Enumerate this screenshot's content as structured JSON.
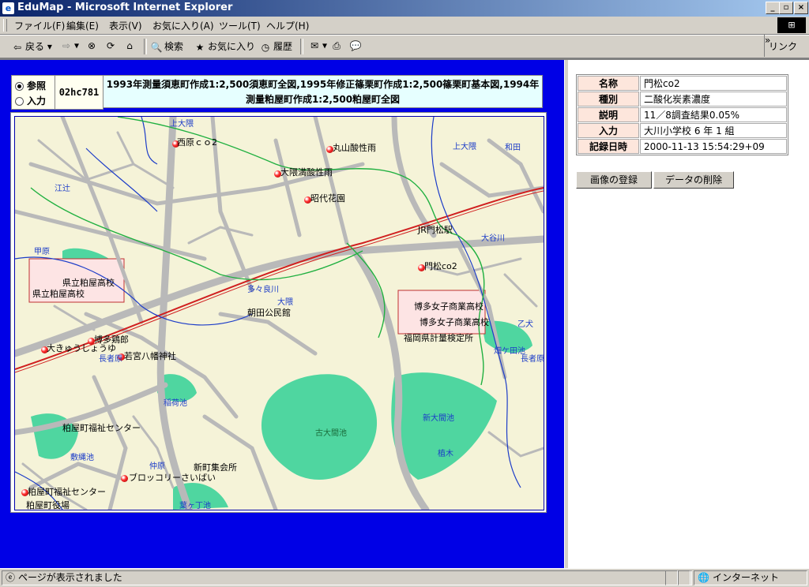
{
  "window": {
    "title": "EduMap - Microsoft Internet Explorer",
    "app_icon": "e"
  },
  "menu": [
    "ファイル(F)",
    "編集(E)",
    "表示(V)",
    "お気に入り(A)",
    "ツール(T)",
    "ヘルプ(H)"
  ],
  "toolbar": {
    "back": "戻る",
    "search": "検索",
    "favorites": "お気に入り",
    "history": "履歴",
    "links": "リンク"
  },
  "left": {
    "radio_ref": "参照",
    "radio_input": "入力",
    "code": "02hc781",
    "description": "1993年測量須恵町作成1:2,500須恵町全図,1995年修正篠栗町作成1:2,500篠栗町基本図,1994年測量粕屋町作成1:2,500粕屋町全図"
  },
  "map": {
    "places": [
      "西原ｃｏ2",
      "丸山酸性雨",
      "大隈満酸性雨",
      "昭代花園",
      "JR門松駅",
      "門松co2",
      "県立粕屋高校",
      "県立粕屋高校",
      "朝田公民館",
      "博多女子商業高校",
      "博多女子商業高校",
      "福岡県計量検定所",
      "大きゅうしょうゆ",
      "博多鶏郎",
      "若宮八幡神社",
      "粕屋町福祉センター",
      "新町集会所",
      "ブロッコリーさいばい",
      "粕屋町福祉センター",
      "粕屋町役場"
    ],
    "areas": [
      "古大間池",
      "新大間池",
      "植木",
      "畑ケ田池",
      "敷縄池",
      "甲原",
      "江辻",
      "大隈",
      "上大隈",
      "和田",
      "多々良川",
      "大谷川",
      "長者原",
      "仲原",
      "稲荷池",
      "葉ヶ丁池",
      "上大隈",
      "乙犬",
      "長者原"
    ]
  },
  "info": {
    "rows": [
      {
        "key": "名称",
        "value": "門松co2"
      },
      {
        "key": "種別",
        "value": "二酸化炭素濃度"
      },
      {
        "key": "説明",
        "value": "11／8調査結果0.05%"
      },
      {
        "key": "入力",
        "value": "大川小学校 6 年 1 組"
      },
      {
        "key": "記録日時",
        "value": "2000-11-13 15:54:29+09"
      }
    ],
    "btn_register": "画像の登録",
    "btn_delete": "データの削除"
  },
  "status": {
    "text": "ページが表示されました",
    "zone": "インターネット"
  }
}
